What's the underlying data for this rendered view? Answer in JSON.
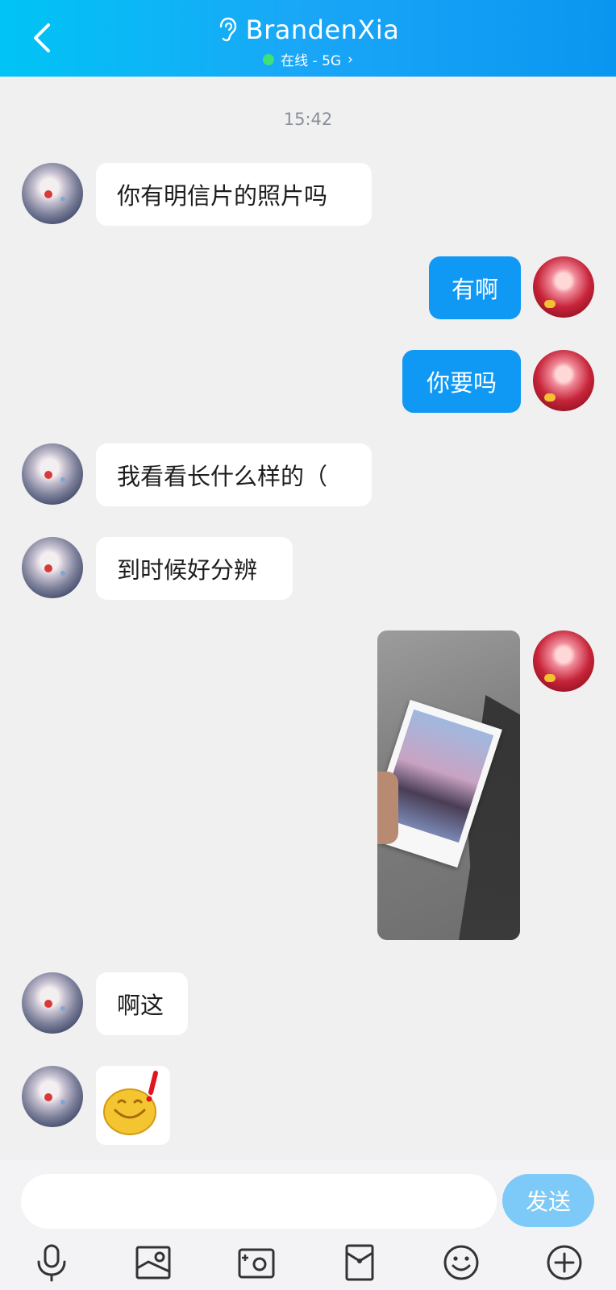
{
  "header": {
    "title": "BrandenXia",
    "status": "在线 - 5G",
    "status_arrow": "›"
  },
  "timestamp": "15:42",
  "messages": [
    {
      "sender": "friend",
      "text": "你有明信片的照片吗"
    },
    {
      "sender": "me",
      "text": "有啊"
    },
    {
      "sender": "me",
      "text": "你要吗"
    },
    {
      "sender": "friend",
      "text": "我看看长什么样的（"
    },
    {
      "sender": "friend",
      "text": "到时候好分辨"
    },
    {
      "sender": "me",
      "type": "image"
    },
    {
      "sender": "friend",
      "text": "啊这"
    },
    {
      "sender": "friend",
      "type": "sticker"
    }
  ],
  "input": {
    "value": "",
    "placeholder": "",
    "send_label": "发送"
  },
  "toolbar": {
    "icons": [
      "microphone-icon",
      "gallery-icon",
      "camera-icon",
      "red-packet-icon",
      "emoji-icon",
      "plus-icon"
    ]
  },
  "colors": {
    "header_start": "#00c4f5",
    "header_end": "#0a96f0",
    "my_bubble": "#0f99f5",
    "friend_bubble": "#ffffff",
    "send_button": "#7dc9f7",
    "online_dot": "#3ee07a",
    "background": "#f0f0f0"
  }
}
